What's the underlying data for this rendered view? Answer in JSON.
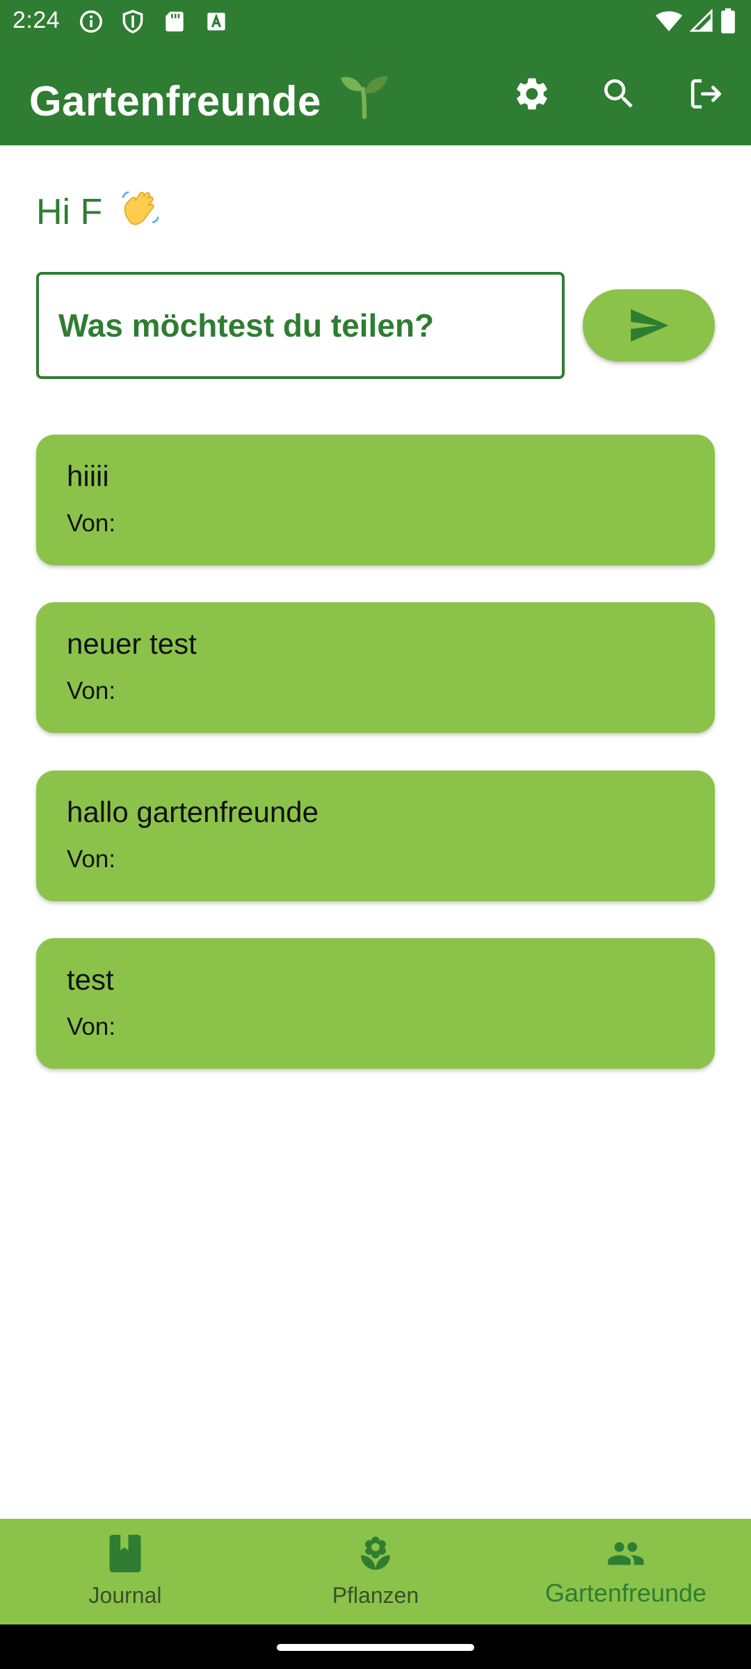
{
  "status_bar": {
    "time": "2:24",
    "left_icons": [
      "info-icon",
      "shield-icon",
      "sd-card-icon",
      "text-a-icon"
    ],
    "right_icons": [
      "wifi-icon",
      "cell-signal-icon",
      "battery-icon"
    ]
  },
  "app_bar": {
    "title": "Gartenfreunde",
    "title_emoji": "seedling-icon",
    "actions": [
      "gear-icon",
      "search-icon",
      "logout-icon"
    ],
    "background": "#2e7d32"
  },
  "greeting": {
    "text": "Hi F",
    "emoji": "waving-hand-icon"
  },
  "composer": {
    "placeholder": "Was möchtest du teilen?",
    "send_icon": "send-icon"
  },
  "posts": [
    {
      "text": "hiiii",
      "author_label": "Von:"
    },
    {
      "text": "neuer test",
      "author_label": "Von:"
    },
    {
      "text": "hallo gartenfreunde",
      "author_label": "Von:"
    },
    {
      "text": "test",
      "author_label": "Von:"
    }
  ],
  "bottom_nav": {
    "items": [
      {
        "label": "Journal",
        "icon": "book-icon",
        "active": false
      },
      {
        "label": "Pflanzen",
        "icon": "flower-icon",
        "active": false
      },
      {
        "label": "Gartenfreunde",
        "icon": "people-icon",
        "active": true
      }
    ]
  },
  "colors": {
    "primary_dark": "#2e7d32",
    "primary_light": "#8bc34a",
    "background": "#ffffff"
  }
}
